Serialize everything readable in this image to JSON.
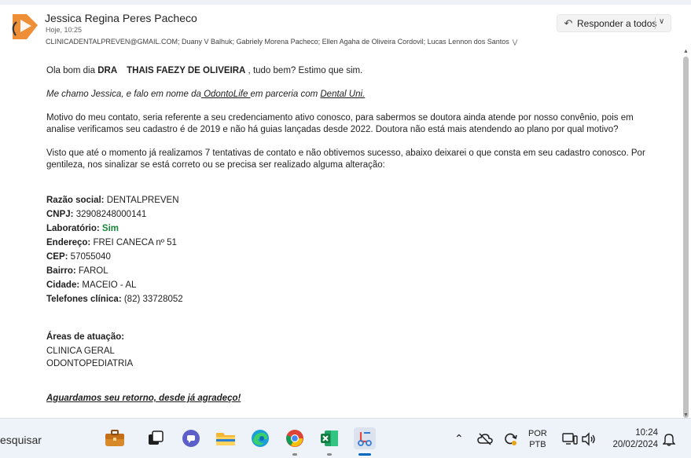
{
  "email": {
    "sender_name": "Jessica Regina Peres Pacheco",
    "time": "Hoje, 10:25",
    "recipients": "CLINICADENTALPREVEN@GMAIL.COM; Duany V Balhuk; Gabriely Morena Pacheco; Ellen Agaha de Oliveira Cordovil; Lucas Lennon dos Santos",
    "reply_all_label": "Responder a todos"
  },
  "body": {
    "greeting_pre": "Ola bom dia ",
    "greeting_title": "DRA",
    "greeting_name": "THAIS FAEZY DE OLIVEIRA",
    "greeting_post": " , tudo bem? Estimo que sim.",
    "intro_pre": "Me chamo Jessica, e falo em nome da",
    "intro_company": " OdontoLife ",
    "intro_mid": "em parceria com ",
    "intro_partner": "Dental Uni.",
    "para1_line1": "Motivo do meu contato, seria referente a seu credenciamento ativo conosco, para sabermos se doutora ainda atende por nosso convênio, pois em",
    "para1_line2": "analise verificamos seu cadastro é de 2019 e não há guias lançadas desde 2022. Doutora não está mais atendendo ao plano por qual motivo?",
    "para2_line1": "Visto que até o momento já realizamos 7 tentativas de contato e não obtivemos sucesso, abaixo deixarei o que consta em seu cadastro conosco. Por",
    "para2_line2": "gentileza, nos sinalizar se está correto ou se precisa ser realizado alguma alteração:",
    "fields": [
      {
        "label": "Razão social:",
        "value": " DENTALPREVEN"
      },
      {
        "label": "CNPJ:",
        "value": " 32908248000141"
      },
      {
        "label": "Laboratório:",
        "value": " Sim"
      },
      {
        "label": "Endereço:",
        "value": " FREI CANECA nº 51"
      },
      {
        "label": "CEP:",
        "value": " 57055040"
      },
      {
        "label": "Bairro:",
        "value": " FAROL"
      },
      {
        "label": "Cidade:",
        "value": " MACEIO - AL"
      },
      {
        "label": "Telefones clínica:",
        "value": " (82) 33728052"
      }
    ],
    "areas_label": "Áreas de atuação:",
    "areas": [
      "CLINICA GERAL",
      "ODONTOPEDIATRIA"
    ],
    "closing": "Aguardamos seu retorno, desde já agradeço!"
  },
  "taskbar": {
    "search_text": "esquisar",
    "language_line1": "POR",
    "language_line2": "PTB",
    "clock_time": "10:24",
    "clock_date": "20/02/2024"
  }
}
